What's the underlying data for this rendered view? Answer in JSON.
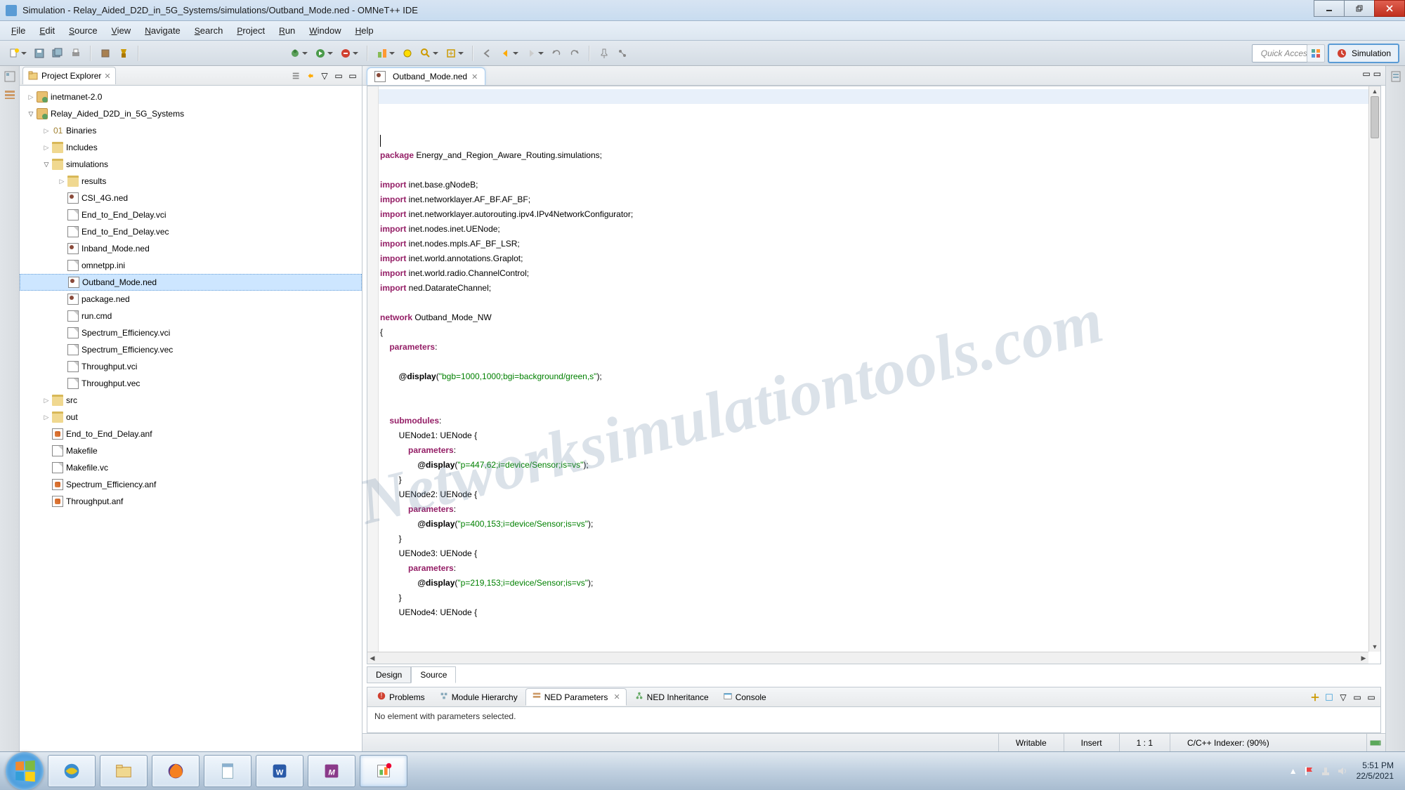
{
  "window": {
    "title": "Simulation - Relay_Aided_D2D_in_5G_Systems/simulations/Outband_Mode.ned - OMNeT++ IDE"
  },
  "menu": [
    "File",
    "Edit",
    "Source",
    "View",
    "Navigate",
    "Search",
    "Project",
    "Run",
    "Window",
    "Help"
  ],
  "quick_access": "Quick Access",
  "perspective": {
    "label": "Simulation"
  },
  "explorer": {
    "title": "Project Explorer",
    "tree": [
      {
        "indent": 0,
        "twist": "closed",
        "iconcls": "fproj",
        "label": "inetmanet-2.0"
      },
      {
        "indent": 0,
        "twist": "open",
        "iconcls": "fproj",
        "label": "Relay_Aided_D2D_in_5G_Systems"
      },
      {
        "indent": 1,
        "twist": "closed",
        "iconcls": "fbin",
        "label": "Binaries"
      },
      {
        "indent": 1,
        "twist": "closed",
        "iconcls": "ffolder",
        "label": "Includes"
      },
      {
        "indent": 1,
        "twist": "open",
        "iconcls": "ffolder",
        "label": "simulations"
      },
      {
        "indent": 2,
        "twist": "closed",
        "iconcls": "ffolder",
        "label": "results"
      },
      {
        "indent": 2,
        "twist": "",
        "iconcls": "fned",
        "label": "CSI_4G.ned"
      },
      {
        "indent": 2,
        "twist": "",
        "iconcls": "fgeneric",
        "label": "End_to_End_Delay.vci"
      },
      {
        "indent": 2,
        "twist": "",
        "iconcls": "fgeneric",
        "label": "End_to_End_Delay.vec"
      },
      {
        "indent": 2,
        "twist": "",
        "iconcls": "fned",
        "label": "Inband_Mode.ned"
      },
      {
        "indent": 2,
        "twist": "",
        "iconcls": "fgeneric",
        "label": "omnetpp.ini"
      },
      {
        "indent": 2,
        "twist": "",
        "iconcls": "fned",
        "label": "Outband_Mode.ned",
        "selected": true
      },
      {
        "indent": 2,
        "twist": "",
        "iconcls": "fned",
        "label": "package.ned"
      },
      {
        "indent": 2,
        "twist": "",
        "iconcls": "fgeneric",
        "label": "run.cmd"
      },
      {
        "indent": 2,
        "twist": "",
        "iconcls": "fgeneric",
        "label": "Spectrum_Efficiency.vci"
      },
      {
        "indent": 2,
        "twist": "",
        "iconcls": "fgeneric",
        "label": "Spectrum_Efficiency.vec"
      },
      {
        "indent": 2,
        "twist": "",
        "iconcls": "fgeneric",
        "label": "Throughput.vci"
      },
      {
        "indent": 2,
        "twist": "",
        "iconcls": "fgeneric",
        "label": "Throughput.vec"
      },
      {
        "indent": 1,
        "twist": "closed",
        "iconcls": "ffolder",
        "label": "src"
      },
      {
        "indent": 1,
        "twist": "closed",
        "iconcls": "ffolder",
        "label": "out"
      },
      {
        "indent": 1,
        "twist": "",
        "iconcls": "fanf",
        "label": "End_to_End_Delay.anf"
      },
      {
        "indent": 1,
        "twist": "",
        "iconcls": "fgeneric",
        "label": "Makefile"
      },
      {
        "indent": 1,
        "twist": "",
        "iconcls": "fgeneric",
        "label": "Makefile.vc"
      },
      {
        "indent": 1,
        "twist": "",
        "iconcls": "fanf",
        "label": "Spectrum_Efficiency.anf"
      },
      {
        "indent": 1,
        "twist": "",
        "iconcls": "fanf",
        "label": "Throughput.anf"
      }
    ]
  },
  "editor": {
    "tab": "Outband_Mode.ned",
    "bottom_tabs": [
      "Design",
      "Source"
    ],
    "active_bottom": 1,
    "code_tokens": [
      [],
      [
        [
          "kw",
          "package"
        ],
        [
          "",
          " Energy_and_Region_Aware_Routing.simulations;"
        ]
      ],
      [],
      [
        [
          "kw",
          "import"
        ],
        [
          "",
          " inet.base.gNodeB;"
        ]
      ],
      [
        [
          "kw",
          "import"
        ],
        [
          "",
          " inet.networklayer.AF_BF.AF_BF;"
        ]
      ],
      [
        [
          "kw",
          "import"
        ],
        [
          "",
          " inet.networklayer.autorouting.ipv4.IPv4NetworkConfigurator;"
        ]
      ],
      [
        [
          "kw",
          "import"
        ],
        [
          "",
          " inet.nodes.inet.UENode;"
        ]
      ],
      [
        [
          "kw",
          "import"
        ],
        [
          "",
          " inet.nodes.mpls.AF_BF_LSR;"
        ]
      ],
      [
        [
          "kw",
          "import"
        ],
        [
          "",
          " inet.world.annotations.Graplot;"
        ]
      ],
      [
        [
          "kw",
          "import"
        ],
        [
          "",
          " inet.world.radio.ChannelControl;"
        ]
      ],
      [
        [
          "kw",
          "import"
        ],
        [
          "",
          " ned.DatarateChannel;"
        ]
      ],
      [],
      [
        [
          "kw",
          "network"
        ],
        [
          "",
          " Outband_Mode_NW"
        ]
      ],
      [
        [
          "",
          "{"
        ]
      ],
      [
        [
          "",
          "    "
        ],
        [
          "kw",
          "parameters"
        ],
        [
          "",
          ":"
        ]
      ],
      [],
      [
        [
          "",
          "        "
        ],
        [
          "ann",
          "@display"
        ],
        [
          "",
          "("
        ],
        [
          "str",
          "\"bgb=1000,1000;bgi=background/green,s\""
        ],
        [
          "",
          ");"
        ]
      ],
      [],
      [],
      [
        [
          "",
          "    "
        ],
        [
          "kw",
          "submodules"
        ],
        [
          "",
          ":"
        ]
      ],
      [
        [
          "",
          "        UENode1: UENode {"
        ]
      ],
      [
        [
          "",
          "            "
        ],
        [
          "kw",
          "parameters"
        ],
        [
          "",
          ":"
        ]
      ],
      [
        [
          "",
          "                "
        ],
        [
          "ann",
          "@display"
        ],
        [
          "",
          "("
        ],
        [
          "str",
          "\"p=447,62;i=device/Sensor;is=vs\""
        ],
        [
          "",
          ");"
        ]
      ],
      [
        [
          "",
          "        }"
        ]
      ],
      [
        [
          "",
          "        UENode2: UENode {"
        ]
      ],
      [
        [
          "",
          "            "
        ],
        [
          "kw",
          "parameters"
        ],
        [
          "",
          ":"
        ]
      ],
      [
        [
          "",
          "                "
        ],
        [
          "ann",
          "@display"
        ],
        [
          "",
          "("
        ],
        [
          "str",
          "\"p=400,153;i=device/Sensor;is=vs\""
        ],
        [
          "",
          ");"
        ]
      ],
      [
        [
          "",
          "        }"
        ]
      ],
      [
        [
          "",
          "        UENode3: UENode {"
        ]
      ],
      [
        [
          "",
          "            "
        ],
        [
          "kw",
          "parameters"
        ],
        [
          "",
          ":"
        ]
      ],
      [
        [
          "",
          "                "
        ],
        [
          "ann",
          "@display"
        ],
        [
          "",
          "("
        ],
        [
          "str",
          "\"p=219,153;i=device/Sensor;is=vs\""
        ],
        [
          "",
          ");"
        ]
      ],
      [
        [
          "",
          "        }"
        ]
      ],
      [
        [
          "",
          "        UENode4: UENode {"
        ]
      ]
    ]
  },
  "bottom_panel": {
    "tabs": [
      "Problems",
      "Module Hierarchy",
      "NED Parameters",
      "NED Inheritance",
      "Console"
    ],
    "active": 2,
    "message": "No element with parameters selected."
  },
  "status": {
    "writable": "Writable",
    "insert": "Insert",
    "pos": "1 : 1",
    "indexer": "C/C++ Indexer: (90%)"
  },
  "tray": {
    "time": "5:51 PM",
    "date": "22/5/2021"
  },
  "watermark": "Networksimulationtools.com"
}
